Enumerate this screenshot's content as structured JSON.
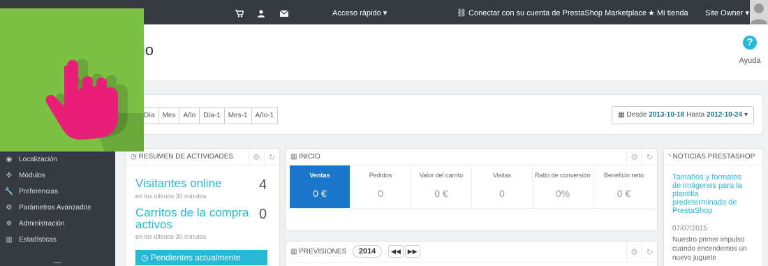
{
  "topbar": {
    "quick_access": "Acceso rápido",
    "marketplace": "Conectar con su cuenta de PrestaShop Marketplace",
    "my_store": "Mi tienda",
    "user": "Site Owner"
  },
  "header": {
    "breadcrumb": "o",
    "title": "icio",
    "help": "Ayuda"
  },
  "sidebar": {
    "items": [
      {
        "icon": "globe-icon",
        "label": "Localización"
      },
      {
        "icon": "puzzle-icon",
        "label": "Módulos"
      },
      {
        "icon": "wrench-icon",
        "label": "Preferencias"
      },
      {
        "icon": "cogs-icon",
        "label": "Parámetros Avanzados"
      },
      {
        "icon": "gear-icon",
        "label": "Administración"
      },
      {
        "icon": "chart-icon",
        "label": "Estadísticas"
      }
    ]
  },
  "filters": {
    "periods": [
      "Día",
      "Mes",
      "Año",
      "Día-1",
      "Mes-1",
      "Año-1"
    ],
    "date_from_label": "Desde",
    "date_from": "2013-10-18",
    "date_to_label": "Hasta",
    "date_to": "2012-10-24"
  },
  "activity": {
    "title": "Resumen de actividades",
    "visitors_label": "Visitantes online",
    "visitors_value": "4",
    "visitors_sub": "en los últimos 30 minutos",
    "carts_label_1": "Carritos de la compra",
    "carts_label_2": "activos",
    "carts_value": "0",
    "carts_sub": "en los últimos 30 minutos",
    "pending": "Pendientes actualmente"
  },
  "inicio": {
    "title": "Inicio",
    "kpis": [
      {
        "label": "Ventas",
        "value": "0 €"
      },
      {
        "label": "Pedidos",
        "value": "0"
      },
      {
        "label": "Valor del carrito",
        "value": "0 €"
      },
      {
        "label": "Visitas",
        "value": "0"
      },
      {
        "label": "Ratio de conversión",
        "value": "0%"
      },
      {
        "label": "Beneficio neto",
        "value": "0 €"
      }
    ]
  },
  "forecast": {
    "title": "Previsiones",
    "year": "2014"
  },
  "news": {
    "title": "Noticias PrestaShop",
    "headline": "Tamaños y formatos de imágenes para la plantilla predeterminada de PrestaShop",
    "date": "07/07/2015",
    "excerpt": "Nuestro primer impulso cuando encendemos un nuevo juguete"
  },
  "colors": {
    "topbar": "#363a41",
    "accent": "#25b9d7",
    "active_kpi": "#1a77c9",
    "overlay_green": "#7bc144",
    "hand_pink": "#e91e78"
  }
}
